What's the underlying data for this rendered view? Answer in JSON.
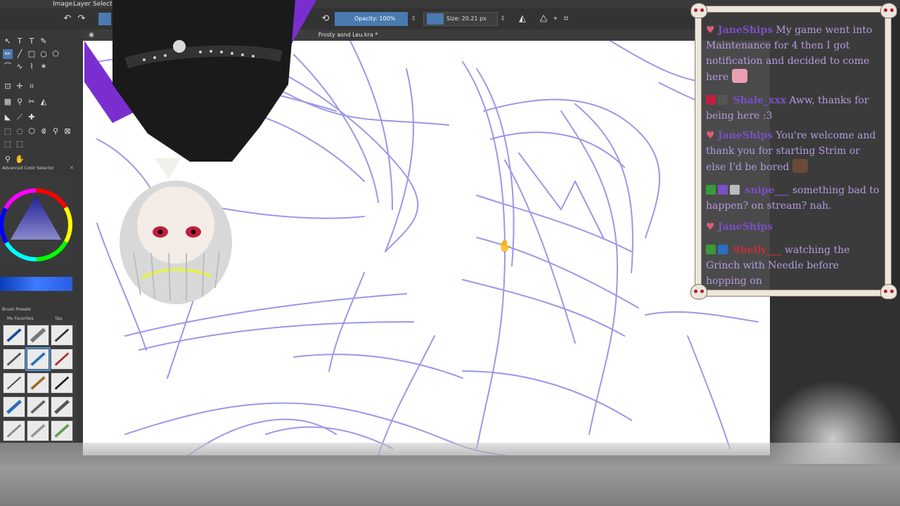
{
  "menu": {
    "items": [
      "Image",
      "Layer",
      "Select"
    ]
  },
  "toolbar": {
    "opacity_label": "Opacity: 100%",
    "size_label": "Size: 20.21 px"
  },
  "document": {
    "title": "Frosty asnd Leu.kra *"
  },
  "left_panel": {
    "color_selector_title": "Advanced Color Selector",
    "brush_presets_title": "Brush Presets",
    "favorites_label": "My Favorites",
    "tag_label": "Tag"
  },
  "chat": {
    "messages": [
      {
        "name": "JaneShips",
        "text": " My game went into Maintenance for 4 then I got notification and decided to come here"
      },
      {
        "name": "Shale_xxx",
        "text": " Aww, thanks for being here :3"
      },
      {
        "name": "JaneShips",
        "text": " You're welcome and thank you for starting Strim or else I'd be bored"
      },
      {
        "name": "snipe___",
        "text": " something bad to happen? on stream? nah."
      },
      {
        "name": "JaneShips",
        "text": ""
      },
      {
        "name": "Shelly___",
        "text": " watching the Grinch with Needle before hopping on"
      }
    ],
    "colors": {
      "name": "#7a4fc8",
      "text": "#b59ae0",
      "heart": "#e05a7a"
    }
  },
  "colors": {
    "accent": "#4a7ab0",
    "stroke": "#8a86e6"
  }
}
